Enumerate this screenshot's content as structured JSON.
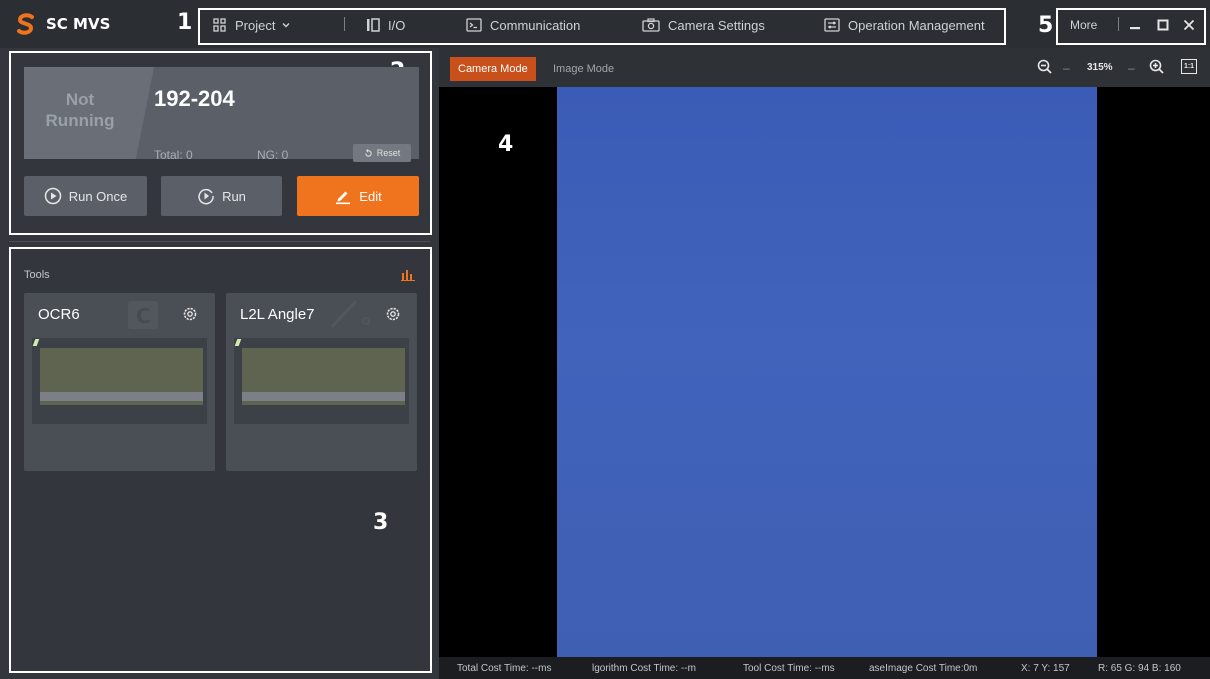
{
  "app": {
    "name": "SC MVS",
    "logo_color": "#f0731d"
  },
  "callouts": {
    "c1": "1",
    "c2": "2",
    "c3": "3",
    "c4": "4",
    "c5": "5"
  },
  "menu": {
    "project": "Project",
    "io": "I/O",
    "communication": "Communication",
    "camera_settings": "Camera Settings",
    "operation_management": "Operation Management"
  },
  "window_controls": {
    "more": "More"
  },
  "run_status": {
    "status_line1": "Not",
    "status_line2": "Running",
    "solution_id": "192-204",
    "total_label": "Total: 0",
    "ng_label": "NG: 0",
    "reset_label": "Reset"
  },
  "actions": {
    "run_once": "Run Once",
    "run": "Run",
    "edit": "Edit"
  },
  "tools": {
    "label": "Tools",
    "items": [
      {
        "name": "OCR6"
      },
      {
        "name": "L2L Angle7"
      }
    ]
  },
  "viewer": {
    "camera_mode": "Camera Mode",
    "image_mode": "Image Mode",
    "zoom": "315%",
    "fit_label": "1:1"
  },
  "status_bar": {
    "total_cost": "Total Cost Time: --ms",
    "algorithm_cost": "lgorithm Cost Time: --m",
    "tool_cost": "Tool Cost Time: --ms",
    "base_image_cost": "aseImage Cost Time:0m",
    "coords": "X: 7 Y: 157",
    "rgb": "R: 65 G: 94 B: 160"
  },
  "colors": {
    "accent": "#f0731d",
    "camera_mode_active": "#c9501b",
    "topbar": "#2b2e33",
    "panel": "#33373d",
    "image": "#3f60b6"
  }
}
